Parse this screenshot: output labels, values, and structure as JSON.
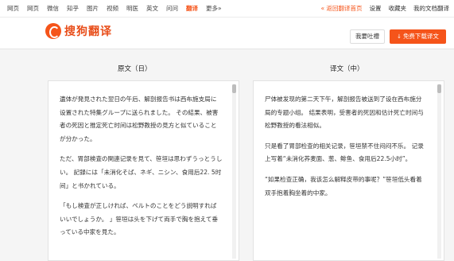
{
  "topnav": {
    "items": [
      "网页",
      "网页",
      "微信",
      "知乎",
      "图片",
      "视频",
      "明医",
      "英文",
      "问问",
      "翻译",
      "更多»"
    ],
    "active_index": 9,
    "back_link": "« 返回翻译首页",
    "settings": "设置",
    "favorites": "收藏夹",
    "my_docs": "我的文档翻译"
  },
  "header": {
    "logo_text": "搜狗翻译",
    "feedback_label": "我要吐槽",
    "download_label": "免费下载译文",
    "download_icon": "↓"
  },
  "panels": {
    "source_title": "原文（日）",
    "target_title": "译文（中）",
    "source_paragraphs": [
      "遺体が発見された翌日の午后、解剖报告书は西布施支局に设置された特集グループに送られました。 その結果、被害者の死因と推定死亡时间は松野教授の見方と似ていることが分かった。",
      "ただ、胃部検査の関連记录を見て、笹垣は思わずうっとうしい。 記録には「未消化そば、ネギ、ニシン、食用后22. 5时间」と书かれている。",
      "「もし検査が正しければ、ベルトのことをどう説明すればいいでしょうか。 」笹垣は头を下げて両手で胸を抱えて垂っている中家を見た。"
    ],
    "target_paragraphs": [
      "尸体被发现的第二天下午，解剖报告被送到了设在西布施分局的专题小组。 结果表明，受害者的死因和估计死亡时间与松野教授的看法相似。",
      "只是看了胃部检查的相关记录，笹垣禁不住闷闷不乐。 记录上写着“未消化荞麦面、葱、鲱鱼、食用后22.5小时”。",
      "“如果检查正确，我该怎么解释皮带的事呢？”笹垣低头看着双手抱着胸坐着的中家。"
    ]
  }
}
